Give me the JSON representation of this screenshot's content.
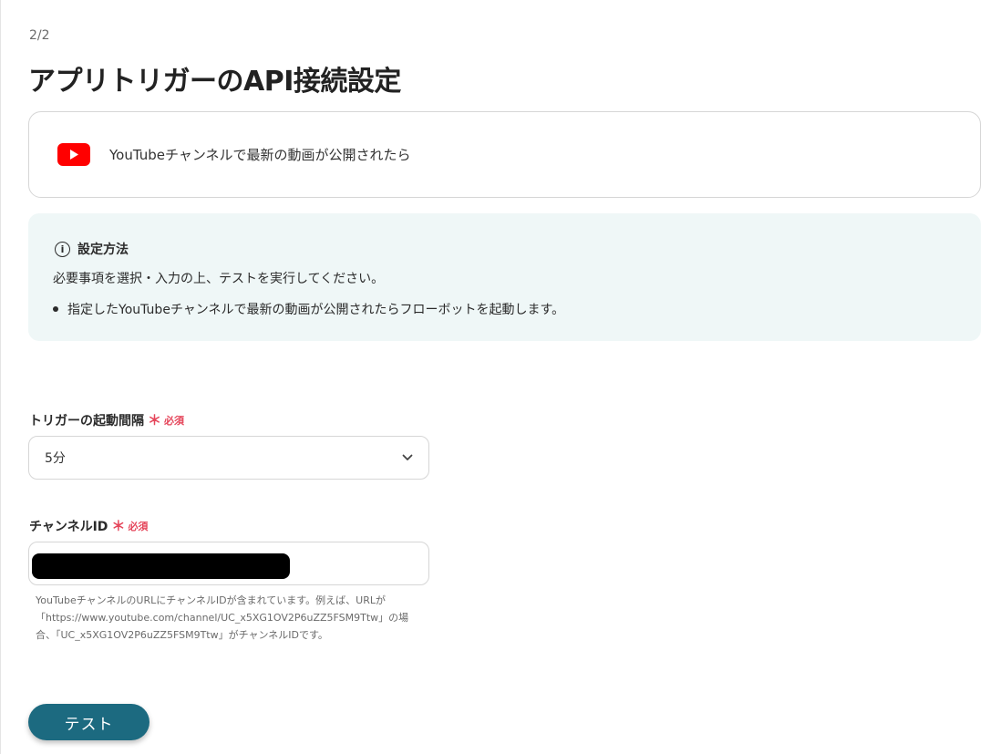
{
  "step": "2/2",
  "title": "アプリトリガーのAPI接続設定",
  "app_card": {
    "icon": "youtube-icon",
    "text": "YouTubeチャンネルで最新の動画が公開されたら"
  },
  "info": {
    "icon": "info-icon",
    "title": "設定方法",
    "description": "必要事項を選択・入力の上、テストを実行してください。",
    "bullets": [
      "指定したYouTubeチャンネルで最新の動画が公開されたらフローボットを起動します。"
    ]
  },
  "fields": {
    "interval": {
      "label": "トリガーの起動間隔",
      "required_mark": "＊",
      "required_label": "必須",
      "value": "5分"
    },
    "channel_id": {
      "label": "チャンネルID",
      "required_mark": "＊",
      "required_label": "必須",
      "help_lines": [
        "YouTubeチャンネルのURLにチャンネルIDが含まれています。例えば、URLが",
        "「https://www.youtube.com/channel/UC_x5XG1OV2P6uZZ5FSM9Ttw」の場",
        "合、「UC_x5XG1OV2P6uZZ5FSM9Ttw」がチャンネルIDです。"
      ]
    }
  },
  "button": {
    "label": "テスト"
  },
  "colors": {
    "accent": "#1c6a80",
    "required": "#e5455a",
    "info_bg": "#eff7f7",
    "youtube_red": "#ff0000"
  }
}
